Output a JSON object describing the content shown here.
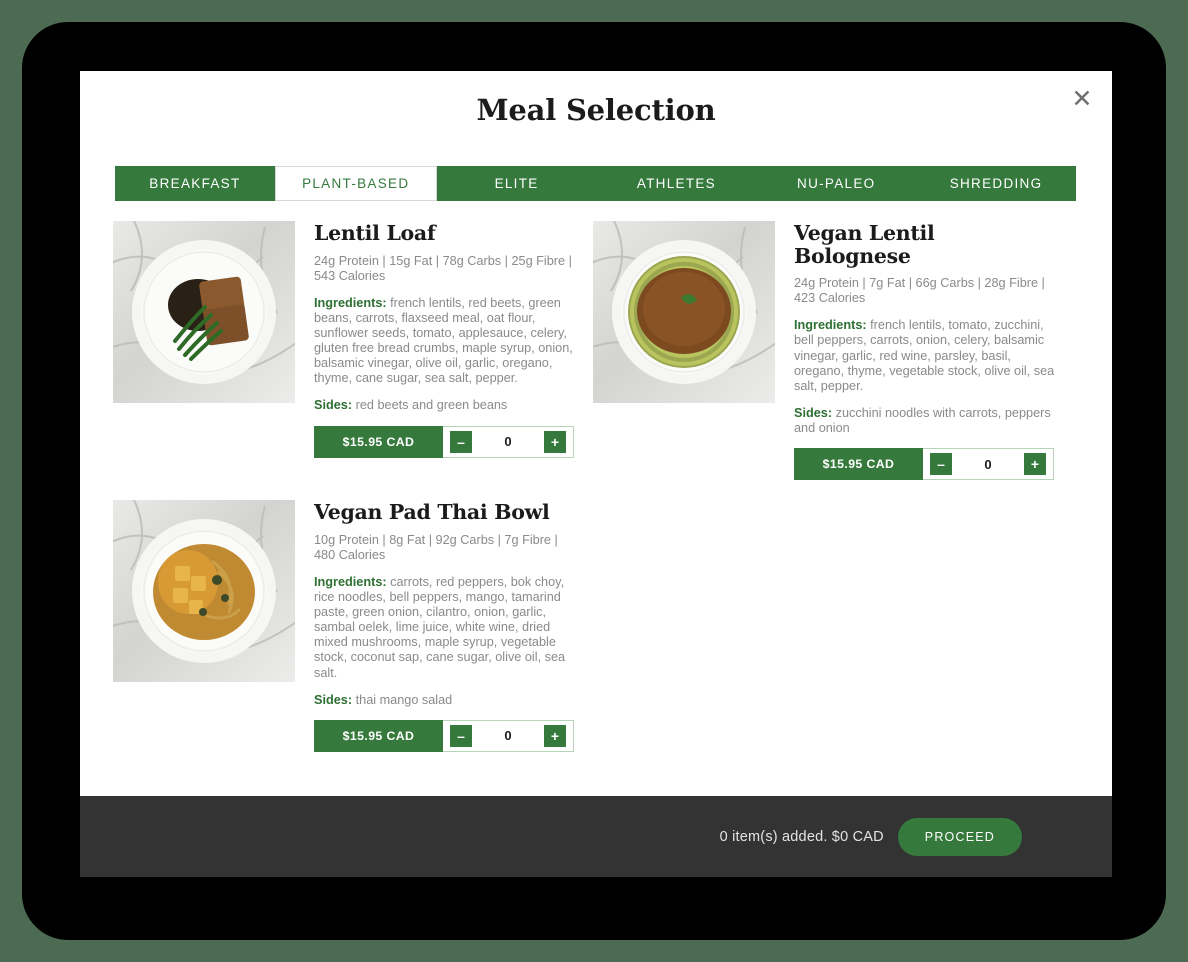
{
  "colors": {
    "brand_green": "#35793c",
    "footer_dark": "#333333",
    "backdrop": "#000000",
    "page_background": "#4c6b52",
    "muted_text": "#8a8a8a"
  },
  "modal": {
    "title": "Meal Selection",
    "close_label": "✕"
  },
  "tabs": [
    {
      "label": "BREAKFAST",
      "active": false
    },
    {
      "label": "PLANT-BASED",
      "active": true
    },
    {
      "label": "ELITE",
      "active": false
    },
    {
      "label": "ATHLETES",
      "active": false
    },
    {
      "label": "NU-PALEO",
      "active": false
    },
    {
      "label": "SHREDDING",
      "active": false
    }
  ],
  "labels": {
    "ingredients": "Ingredients:",
    "sides": "Sides:",
    "minus": "–",
    "plus": "+"
  },
  "meals": [
    {
      "name": "Lentil Loaf",
      "macros": "24g Protein | 15g Fat | 78g Carbs | 25g Fibre | 543 Calories",
      "ingredients": "french lentils, red beets, green beans, carrots, flaxseed meal, oat flour, sunflower seeds, tomato, applesauce, celery, gluten free bread crumbs, maple syrup, onion, balsamic vinegar, olive oil, garlic, oregano, thyme, cane sugar, sea salt, pepper.",
      "sides": "red beets and green beans",
      "price": "$15.95 CAD",
      "quantity": "0",
      "photo": "lentil-loaf-plate"
    },
    {
      "name": "Vegan Lentil Bolognese",
      "macros": "24g Protein | 7g Fat | 66g Carbs | 28g Fibre | 423 Calories",
      "ingredients": "french lentils, tomato, zucchini, bell peppers, carrots, onion, celery, balsamic vinegar, garlic, red wine, parsley, basil, oregano, thyme, vegetable stock, olive oil, sea salt, pepper.",
      "sides": "zucchini noodles with carrots, peppers and onion",
      "price": "$15.95 CAD",
      "quantity": "0",
      "photo": "vegan-lentil-bolognese-plate"
    },
    {
      "name": "Vegan Pad Thai Bowl",
      "macros": "10g Protein | 8g Fat | 92g Carbs | 7g Fibre | 480 Calories",
      "ingredients": "carrots, red peppers, bok choy, rice noodles, bell peppers, mango, tamarind paste, green onion, cilantro, onion, garlic, sambal oelek, lime juice, white wine, dried mixed mushrooms, maple syrup, vegetable stock, coconut sap, cane sugar, olive oil, sea salt.",
      "sides": "thai mango salad",
      "price": "$15.95 CAD",
      "quantity": "0",
      "photo": "vegan-pad-thai-bowl-plate"
    }
  ],
  "footer": {
    "cart_summary": "0 item(s) added. $0 CAD",
    "proceed_label": "PROCEED"
  }
}
